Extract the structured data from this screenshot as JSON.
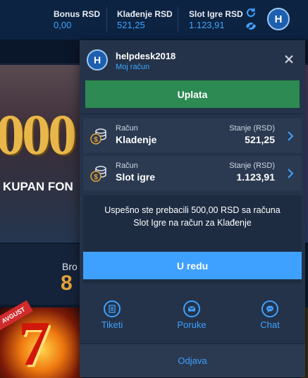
{
  "header": {
    "balances": [
      {
        "label": "Bonus RSD",
        "value": "0,00"
      },
      {
        "label": "Klađenje RSD",
        "value": "521,25"
      },
      {
        "label": "Slot Igre RSD",
        "value": "1.123,91"
      }
    ],
    "avatar_letter": "H",
    "icons": [
      "refresh-icon",
      "eye-icon"
    ]
  },
  "background": {
    "banner_big_text": "000",
    "banner_sub_text": "KUPAN FON",
    "promo_label": "Bro",
    "promo_value": "8",
    "badge_text": "AVGUST",
    "slot_symbol": "7"
  },
  "user_menu": {
    "avatar_letter": "H",
    "username": "helpdesk2018",
    "account_link": "Moj račun",
    "deposit_button": "Uplata",
    "accounts": [
      {
        "sub_label": "Račun",
        "name": "Kladenje",
        "balance_label": "Stanje (RSD)",
        "balance": "521,25"
      },
      {
        "sub_label": "Račun",
        "name": "Slot igre",
        "balance_label": "Stanje (RSD)",
        "balance": "1.123,91"
      }
    ],
    "message": "Uspešno ste prebacili 500,00 RSD sa računa Slot Igre na račun za Klađenje",
    "ok_button": "U redu",
    "actions": [
      {
        "label": "Tiketi",
        "icon": "ticket-icon"
      },
      {
        "label": "Poruke",
        "icon": "envelope-icon"
      },
      {
        "label": "Chat",
        "icon": "chat-icon"
      }
    ],
    "logout_button": "Odjava"
  },
  "colors": {
    "accent_blue": "#3fa1ff",
    "deposit_green": "#2d8a52",
    "panel_bg": "#243349",
    "topbar_bg": "#0d2342"
  }
}
